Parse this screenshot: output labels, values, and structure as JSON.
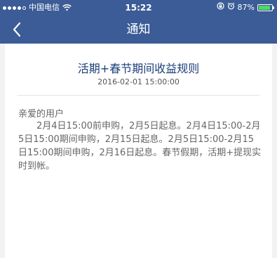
{
  "status_bar": {
    "carrier": "中国电信",
    "time": "15:22",
    "battery_percent": "87%",
    "battery_level": 0.87,
    "signal_bars_filled": 4,
    "signal_bars_total": 5
  },
  "nav": {
    "title": "通知",
    "back_icon": "chevron-left-icon"
  },
  "article": {
    "title": "活期+春节期间收益规则",
    "date": "2016-02-01 15:00:00",
    "greeting": "亲爱的用户",
    "body": "2月4日15:00前申购，2月5日起息。2月4日15:00-2月5日15:00期间申购，2月15日起息。2月5日15:00-2月15日15:00期间申购，2月16日起息。春节假期，活期+提现实时到帐。"
  },
  "colors": {
    "header": "#3b5c96",
    "title": "#1d3f7a",
    "body_text": "#666666",
    "background": "#f2f2f4",
    "battery": "#4cd964"
  }
}
